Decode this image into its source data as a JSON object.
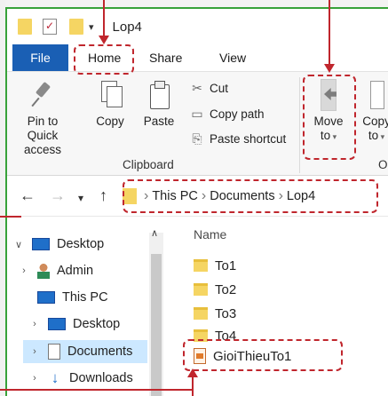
{
  "window": {
    "title": "Lop4"
  },
  "ribbon_tabs": {
    "file": "File",
    "home": "Home",
    "share": "Share",
    "view": "View"
  },
  "clipboard": {
    "pin_to_quick_access": "Pin to Quick access",
    "copy": "Copy",
    "paste": "Paste",
    "cut": "Cut",
    "copy_path": "Copy path",
    "paste_shortcut": "Paste shortcut",
    "group_label": "Clipboard"
  },
  "organize": {
    "move_to_line1": "Move",
    "move_to_line2": "to",
    "copy_to_line1": "Copy",
    "copy_to_line2": "to",
    "group_label": "O"
  },
  "address": {
    "segments": [
      "This PC",
      "Documents",
      "Lop4"
    ]
  },
  "nav_tree": [
    {
      "label": "Desktop"
    },
    {
      "label": "Admin"
    },
    {
      "label": "This PC"
    },
    {
      "label": "Desktop"
    },
    {
      "label": "Documents"
    },
    {
      "label": "Downloads"
    }
  ],
  "files": {
    "column_name": "Name",
    "items": [
      {
        "name": "To1",
        "type": "folder"
      },
      {
        "name": "To2",
        "type": "folder"
      },
      {
        "name": "To3",
        "type": "folder"
      },
      {
        "name": "To4",
        "type": "folder"
      },
      {
        "name": "GioiThieuTo1",
        "type": "file"
      }
    ]
  },
  "colors": {
    "file_tab": "#1a5fb4",
    "highlight": "#c0262d",
    "frame": "#38a23a",
    "selection": "#cce8ff"
  }
}
